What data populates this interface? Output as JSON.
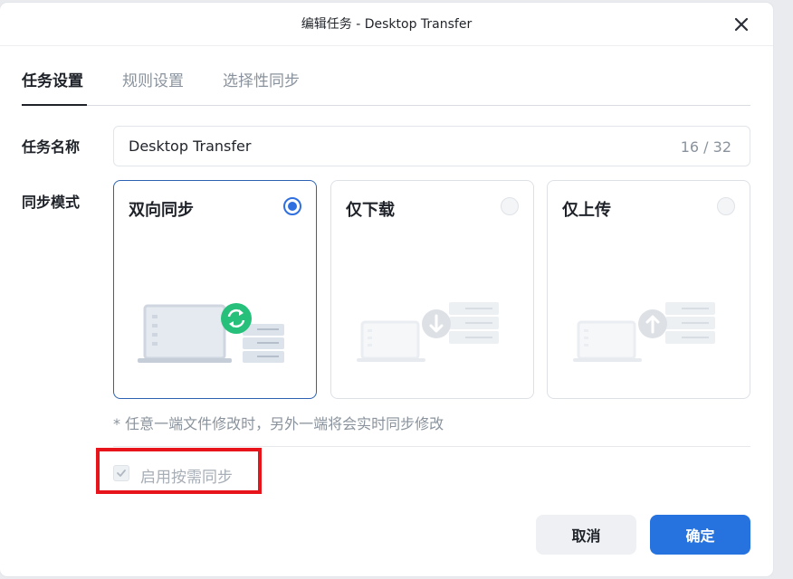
{
  "dialog": {
    "title": "编辑任务 - Desktop Transfer"
  },
  "tabs": [
    {
      "label": "任务设置",
      "active": true
    },
    {
      "label": "规则设置",
      "active": false
    },
    {
      "label": "选择性同步",
      "active": false
    }
  ],
  "task_name": {
    "label": "任务名称",
    "value": "Desktop Transfer",
    "counter": "16 / 32"
  },
  "sync_mode": {
    "label": "同步模式",
    "options": [
      {
        "title": "双向同步",
        "selected": true,
        "icon": "sync-arrows-icon"
      },
      {
        "title": "仅下载",
        "selected": false,
        "icon": "download-arrow-icon"
      },
      {
        "title": "仅上传",
        "selected": false,
        "icon": "upload-arrow-icon"
      }
    ],
    "note": "* 任意一端文件修改时，另外一端将会实时同步修改"
  },
  "on_demand": {
    "label": "启用按需同步",
    "checked": true,
    "disabled": true
  },
  "buttons": {
    "cancel": "取消",
    "ok": "确定"
  },
  "colors": {
    "accent": "#2673e0",
    "sync_green": "#26c07a",
    "highlight": "#e8141b"
  }
}
